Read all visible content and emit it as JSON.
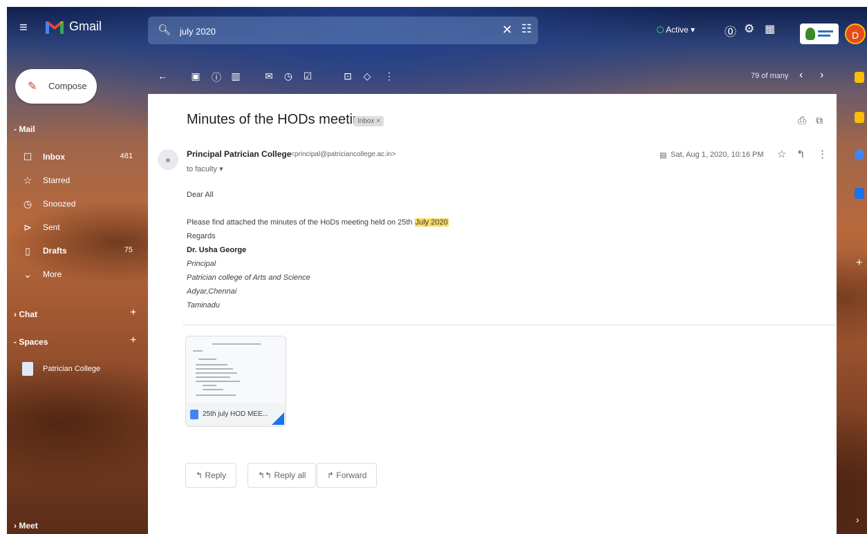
{
  "header": {
    "app_title": "Gmail",
    "search_value": "july 2020",
    "status": "Active ▾",
    "avatar_initial": "D"
  },
  "sidebar": {
    "compose_label": "Compose",
    "mail_section": "Mail",
    "items": [
      {
        "label": "Inbox",
        "count": "481",
        "icon": "inbox-icon",
        "bold": true
      },
      {
        "label": "Starred",
        "count": "",
        "icon": "star-icon",
        "bold": false
      },
      {
        "label": "Snoozed",
        "count": "",
        "icon": "clock-icon",
        "bold": false
      },
      {
        "label": "Sent",
        "count": "",
        "icon": "send-icon",
        "bold": false
      },
      {
        "label": "Drafts",
        "count": "75",
        "icon": "draft-icon",
        "bold": true
      },
      {
        "label": "More",
        "count": "",
        "icon": "chevron-down-icon",
        "bold": false
      }
    ],
    "chat_section": "Chat",
    "spaces_section": "Spaces",
    "space_item": "Patrician College",
    "meet_section": "Meet"
  },
  "toolbar": {
    "pager": "79 of many"
  },
  "message": {
    "subject": "Minutes of the HODs meeting",
    "label": "Inbox ×",
    "sender_name": "Principal Patrician College",
    "sender_email": "<principal@patriciancollege.ac.in>",
    "recipient": "to faculty ▾",
    "date": "Sat, Aug 1, 2020, 10:16 PM",
    "greeting": "Dear All",
    "body_prefix": "Please find attached the minutes of the HoDs meeting held on 25th ",
    "body_highlight": "July 2020",
    "regards": "Regards",
    "signature_name": "Dr. Usha George",
    "signature_title": "Principal",
    "signature_org": "Patrician college of Arts and Science",
    "signature_place": "Adyar,Chennai",
    "signature_state": "Taminadu",
    "attachment_name": "25th july HOD MEE..."
  },
  "actions": {
    "reply": "Reply",
    "reply_all": "Reply all",
    "forward": "Forward"
  },
  "colors": {
    "accent": "#1a73e8",
    "compose_icon": "#d93025",
    "highlight": "#fbd95b",
    "avatar": "#e64a19"
  }
}
